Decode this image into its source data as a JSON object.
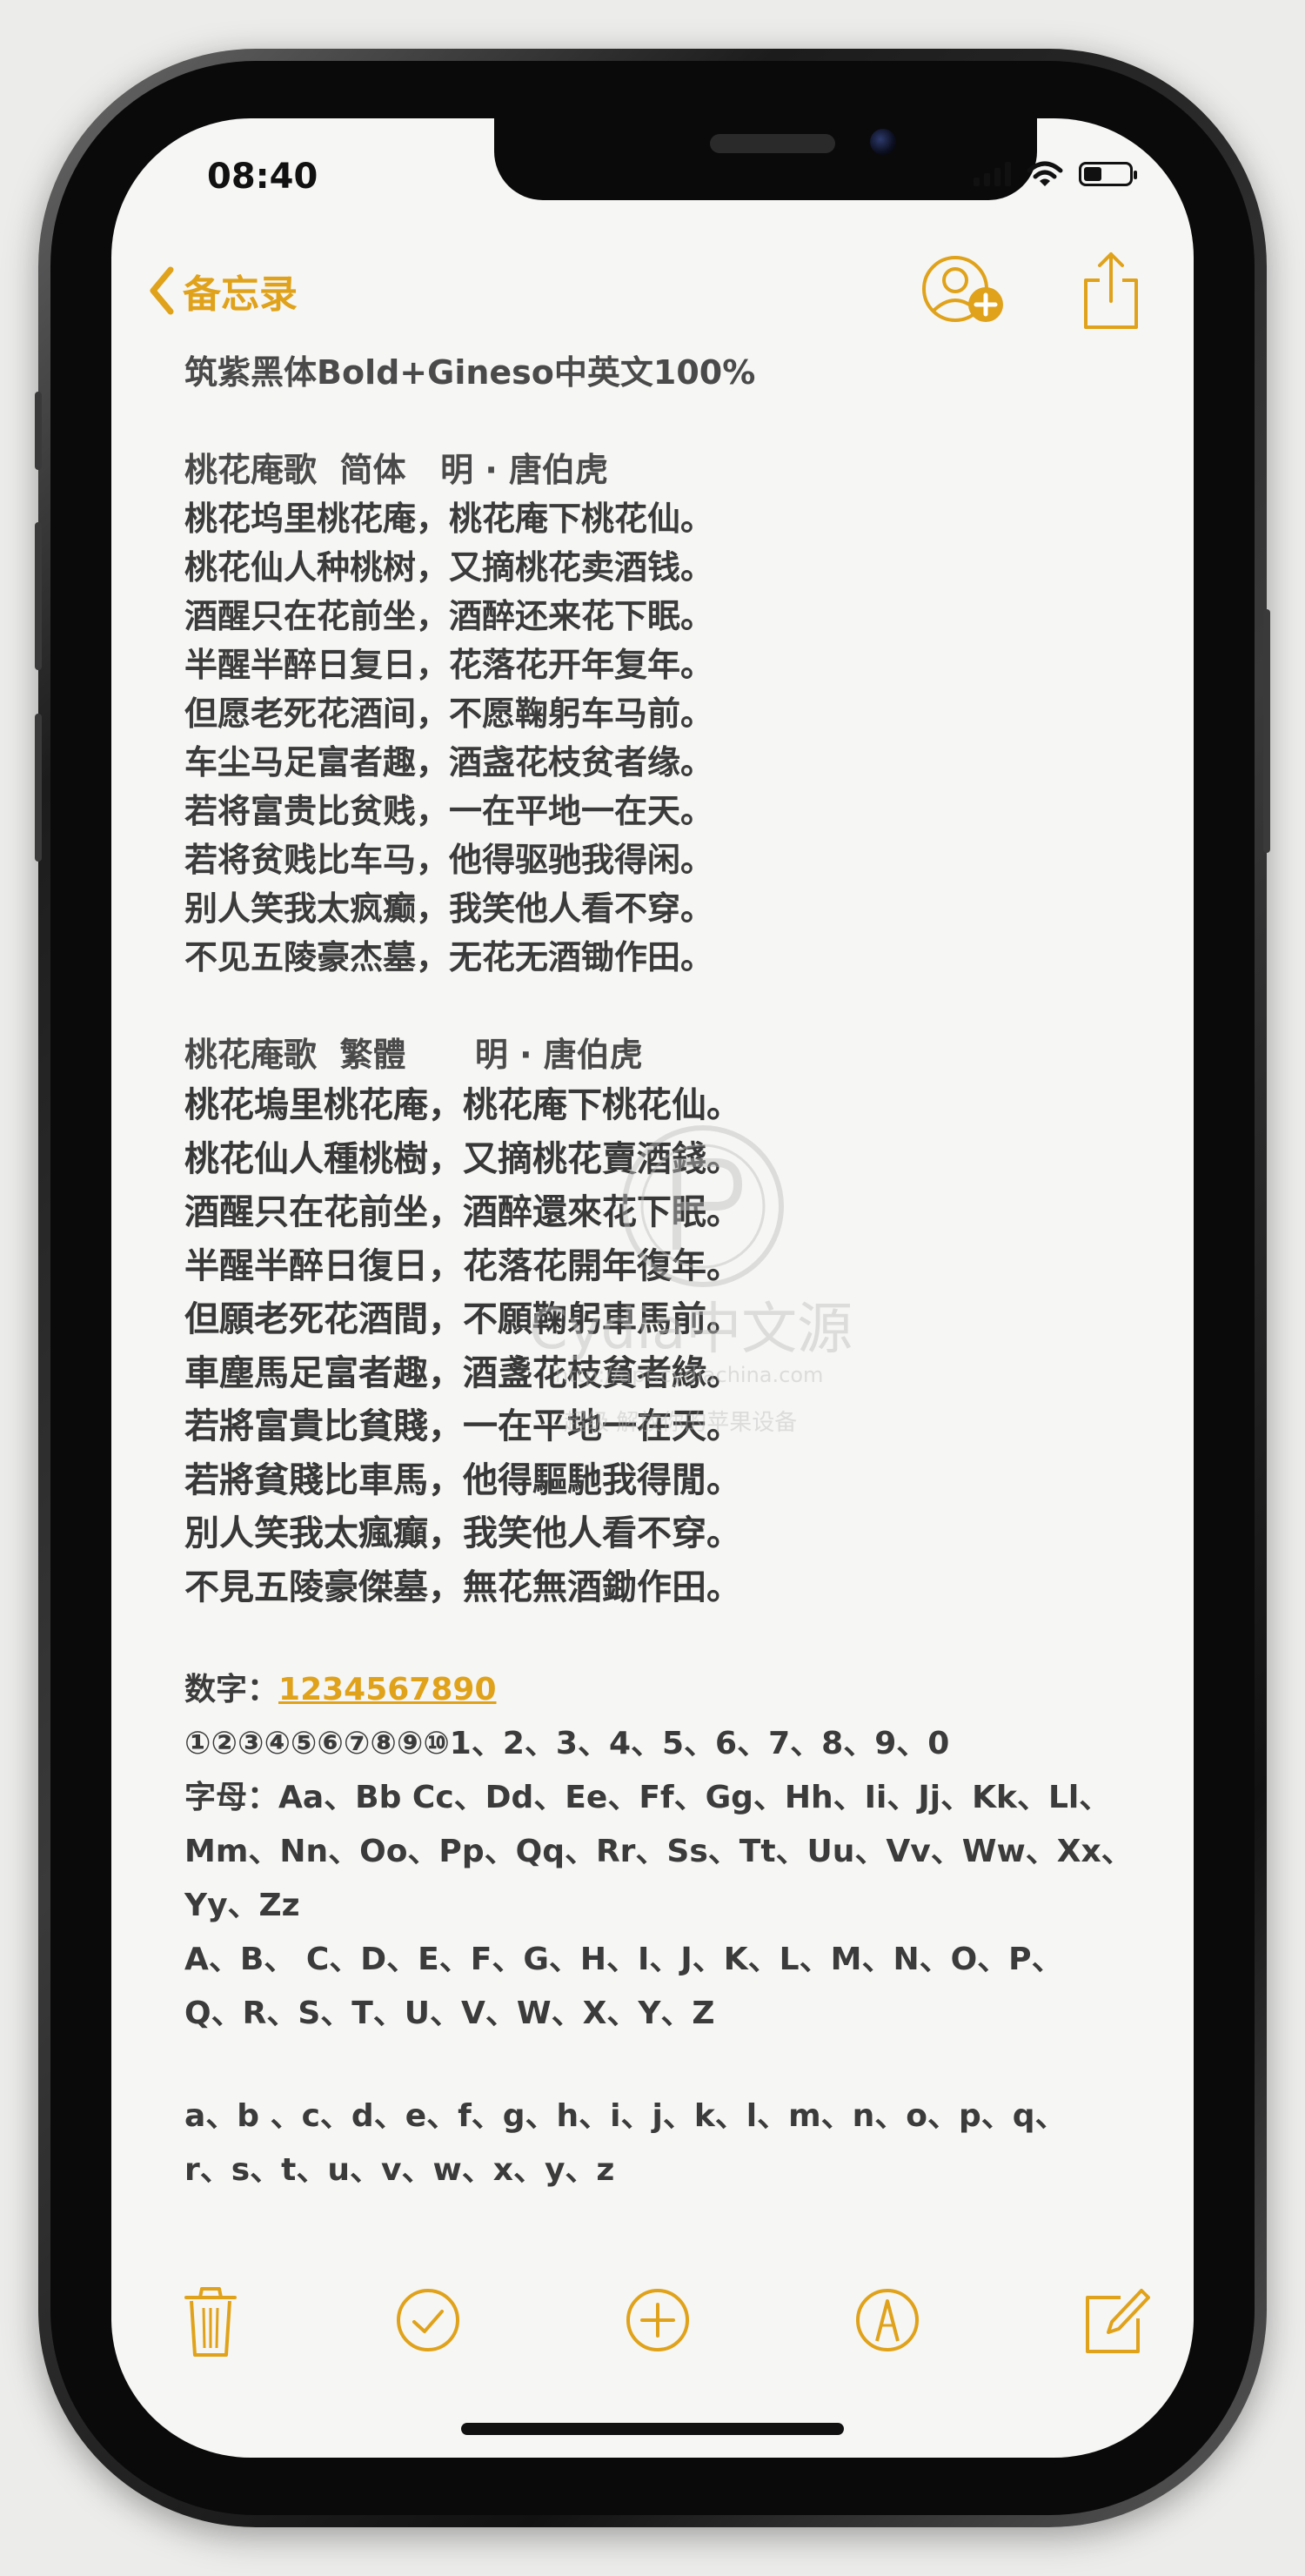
{
  "status_bar": {
    "time": "08:40"
  },
  "nav": {
    "back_label": "备忘录"
  },
  "note": {
    "font_title": "筑紫黑体Bold+Gineso中英文100%",
    "poem_simplified": {
      "heading": "桃花庵歌  简体   明 · 唐伯虎",
      "lines": [
        "桃花坞里桃花庵，桃花庵下桃花仙。",
        "桃花仙人种桃树，又摘桃花卖酒钱。",
        "酒醒只在花前坐，酒醉还来花下眠。",
        "半醒半醉日复日，花落花开年复年。",
        "但愿老死花酒间，不愿鞠躬车马前。",
        "车尘马足富者趣，酒盏花枝贫者缘。",
        "若将富贵比贫贱，一在平地一在天。",
        "若将贫贱比车马，他得驱驰我得闲。",
        "别人笑我太疯癫，我笑他人看不穿。",
        "不见五陵豪杰墓，无花无酒锄作田。"
      ]
    },
    "poem_traditional": {
      "heading": "桃花庵歌  繁體      明 · 唐伯虎",
      "lines": [
        "桃花塢里桃花庵，桃花庵下桃花仙。",
        "桃花仙人種桃樹，又摘桃花賣酒錢。",
        "酒醒只在花前坐，酒醉還來花下眠。",
        "半醒半醉日復日，花落花開年復年。",
        "但願老死花酒間，不願鞠躬車馬前。",
        "車塵馬足富者趣，酒盞花枝貧者緣。",
        "若將富貴比貧賤，一在平地一在天。",
        "若將貧賤比車馬，他得驅馳我得閒。",
        "別人笑我太瘋癲，我笑他人看不穿。",
        "不見五陵豪傑墓，無花無酒鋤作田。"
      ]
    },
    "digits_label": "数字：",
    "digits_link": "1234567890",
    "digits_line": "①②③④⑤⑥⑦⑧⑨⑩1、2、3、4、5、6、7、8、9、0",
    "letters_lines": [
      "字母：Aa、Bb Cc、Dd、Ee、Ff、Gg、Hh、Ii、Jj、Kk、Ll、",
      "Mm、Nn、Oo、Pp、Qq、Rr、Ss、Tt、Uu、Vv、Ww、Xx、",
      "Yy、Zz",
      "A、B、 C、D、E、F、G、H、I、J、K、L、M、N、O、P、",
      "Q、R、S、T、U、V、W、X、Y、Z"
    ],
    "lowercase_lines": [
      "a、b 、c、d、e、f、g、h、i、j、k、l、m、n、o、p、q、",
      "r、s、t、u、v、w、x、y、z"
    ]
  },
  "watermark": {
    "brand": "Cydia中文源",
    "url": "http://apt.cydiachina.com",
    "tagline": "超级 解放你的苹果设备"
  },
  "icons": {
    "back": "chevron-left-icon",
    "contact_add": "person-add-icon",
    "share": "share-icon",
    "trash": "trash-icon",
    "checklist": "checkmark-circle-icon",
    "add": "plus-circle-icon",
    "markup": "pen-tip-circle-icon",
    "compose": "compose-icon"
  },
  "colors": {
    "accent": "#e0a21a",
    "text": "#3b3b3b",
    "paper": "#f6f6f4",
    "bezel": "#0a0a0a"
  }
}
